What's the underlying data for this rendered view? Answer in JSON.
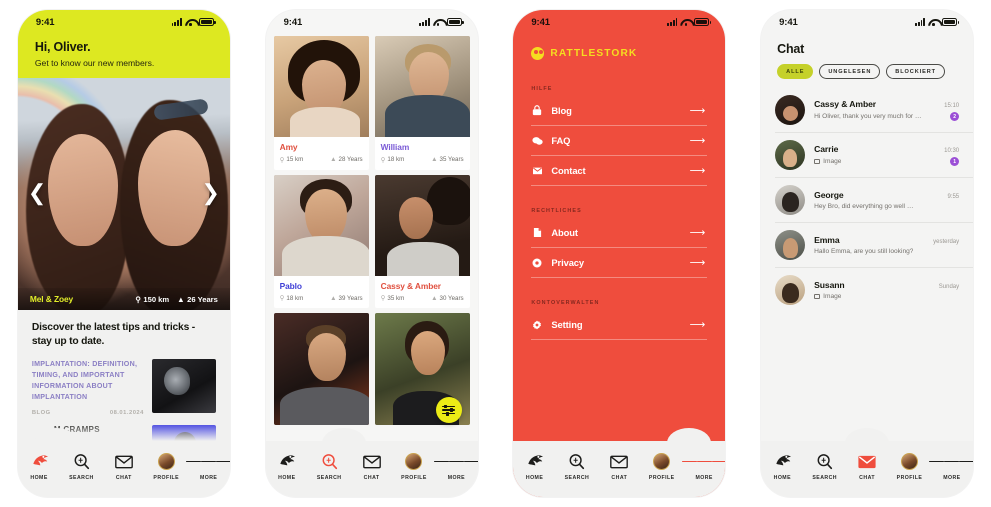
{
  "status_bar": {
    "time": "9:41",
    "signal_icon": "signal-bars-icon",
    "wifi_icon": "wifi-icon",
    "battery_icon": "battery-icon"
  },
  "colors": {
    "brand_red": "#ef4d3d",
    "brand_yellow": "#dde821",
    "accent_yellow": "#ecec16",
    "pill_olive": "#c5d12a",
    "badge_purple": "#9b4fd6",
    "blog_purple": "#8b7fc4"
  },
  "tabbar": {
    "items": [
      {
        "label": "HOME",
        "icon": "stork-home-icon"
      },
      {
        "label": "SEARCH",
        "icon": "search-magnifier-icon"
      },
      {
        "label": "CHAT",
        "icon": "envelope-icon"
      },
      {
        "label": "PROFILE",
        "icon": "avatar-icon"
      },
      {
        "label": "MORE",
        "icon": "hamburger-icon"
      }
    ],
    "active": {
      "home": "HOME",
      "search": "SEARCH",
      "more": "MORE",
      "chat": "CHAT"
    }
  },
  "screen_home": {
    "greeting": "Hi, Oliver.",
    "subtitle": "Get to know our new members.",
    "carousel": {
      "prev_icon": "chevron-left-icon",
      "next_icon": "chevron-right-icon",
      "caption": {
        "name": "Mel & Zoey",
        "distance": "150 km",
        "age": "26 Years",
        "pin_icon": "location-pin-icon",
        "cake_icon": "cake-icon"
      }
    },
    "blog_heading": "Discover the latest tips and tricks - stay up to date.",
    "articles": [
      {
        "title": "IMPLANTATION: DEFINITION, TIMING, AND IMPORTANT INFORMATION ABOUT IMPLANTATION",
        "category": "BLOG",
        "date": "08.01.2024"
      },
      {
        "title": "M CRAMPS"
      }
    ]
  },
  "screen_discover": {
    "cards": [
      {
        "name": "Amy",
        "distance": "15 km",
        "age": "28 Years",
        "name_color": "#e0503f"
      },
      {
        "name": "William",
        "distance": "18 km",
        "age": "35 Years",
        "name_color": "#7a5ad6"
      },
      {
        "name": "Pablo",
        "distance": "18 km",
        "age": "39 Years",
        "name_color": "#3f3fd6"
      },
      {
        "name": "Cassy & Amber",
        "distance": "35 km",
        "age": "30 Years",
        "name_color": "#e0503f"
      }
    ],
    "filter_button": {
      "icon": "sliders-filter-icon"
    }
  },
  "screen_menu": {
    "brand": {
      "name": "RATTLESTORK",
      "logo_icon": "stork-logo-icon"
    },
    "sections": [
      {
        "heading": "HILFE",
        "items": [
          {
            "label": "Blog",
            "icon": "blog-lock-icon",
            "arrow": "arrow-right-icon"
          },
          {
            "label": "FAQ",
            "icon": "faq-chat-icon",
            "arrow": "arrow-right-icon"
          },
          {
            "label": "Contact",
            "icon": "contact-mail-icon",
            "arrow": "arrow-right-icon"
          }
        ]
      },
      {
        "heading": "RECHTLICHES",
        "items": [
          {
            "label": "About",
            "icon": "document-icon",
            "arrow": "arrow-right-icon"
          },
          {
            "label": "Privacy",
            "icon": "shield-privacy-icon",
            "arrow": "arrow-right-icon"
          }
        ]
      },
      {
        "heading": "KONTOVERWALTEN",
        "items": [
          {
            "label": "Setting",
            "icon": "gear-icon",
            "arrow": "arrow-right-icon"
          }
        ]
      }
    ]
  },
  "screen_chat": {
    "title": "Chat",
    "filters": [
      {
        "label": "ALLE",
        "active": true
      },
      {
        "label": "UNGELESEN",
        "active": false
      },
      {
        "label": "BLOCKIERT",
        "active": false
      }
    ],
    "conversations": [
      {
        "name": "Cassy & Amber",
        "preview": "Hi Oliver, thank you very much for …",
        "time": "15:10",
        "unread": "2",
        "has_image": false
      },
      {
        "name": "Carrie",
        "preview": "Image",
        "time": "10:30",
        "unread": "1",
        "has_image": true
      },
      {
        "name": "George",
        "preview": "Hey Bro, did everything go well …",
        "time": "9:55",
        "unread": "",
        "has_image": false
      },
      {
        "name": "Emma",
        "preview": "Hallo Emma, are you still looking?",
        "time": "yesterday",
        "unread": "",
        "has_image": false
      },
      {
        "name": "Susann",
        "preview": "Image",
        "time": "Sunday",
        "unread": "",
        "has_image": true
      }
    ]
  }
}
